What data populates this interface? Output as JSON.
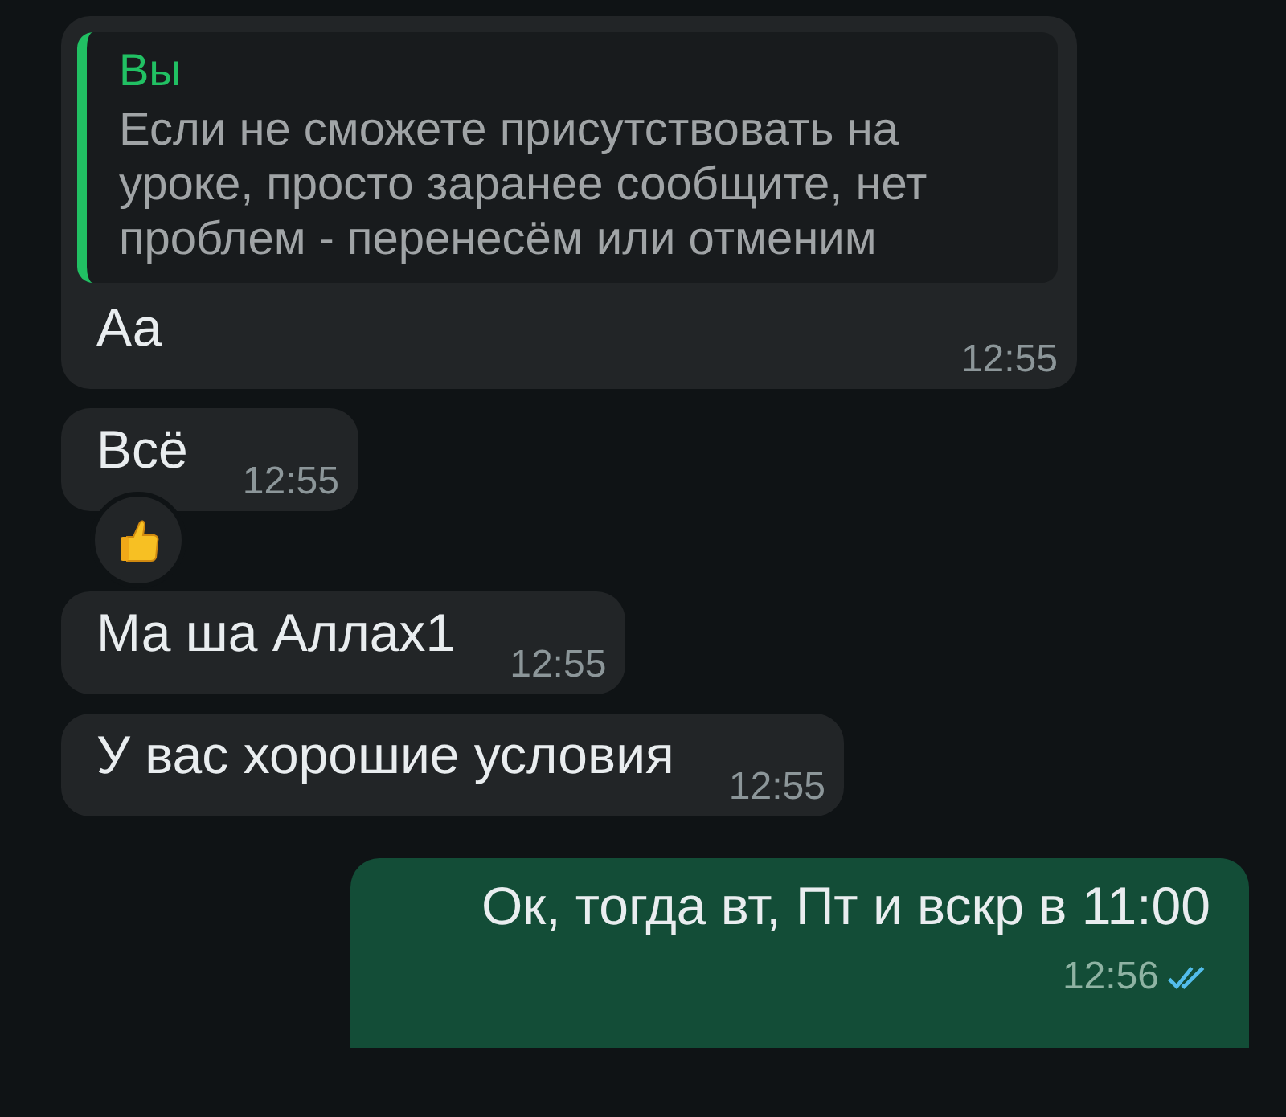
{
  "messages": [
    {
      "kind": "quoted",
      "outgoing": false,
      "quote": {
        "author": "Вы",
        "text": "Если не сможете присутствовать на уроке, просто заранее сообщите, нет проблем - перенесём или отменим"
      },
      "text": "Аа",
      "time": "12:55"
    },
    {
      "kind": "text",
      "outgoing": false,
      "text": "Всё",
      "time": "12:55",
      "reacted": true
    },
    {
      "kind": "text",
      "outgoing": false,
      "text": "Ма ша Аллах1",
      "time": "12:55"
    },
    {
      "kind": "text",
      "outgoing": false,
      "text": "У вас хорошие условия",
      "time": "12:55"
    },
    {
      "kind": "text",
      "outgoing": true,
      "text": "Ок, тогда вт, Пт и вскр в 11:00",
      "time": "12:56",
      "read": true
    }
  ]
}
